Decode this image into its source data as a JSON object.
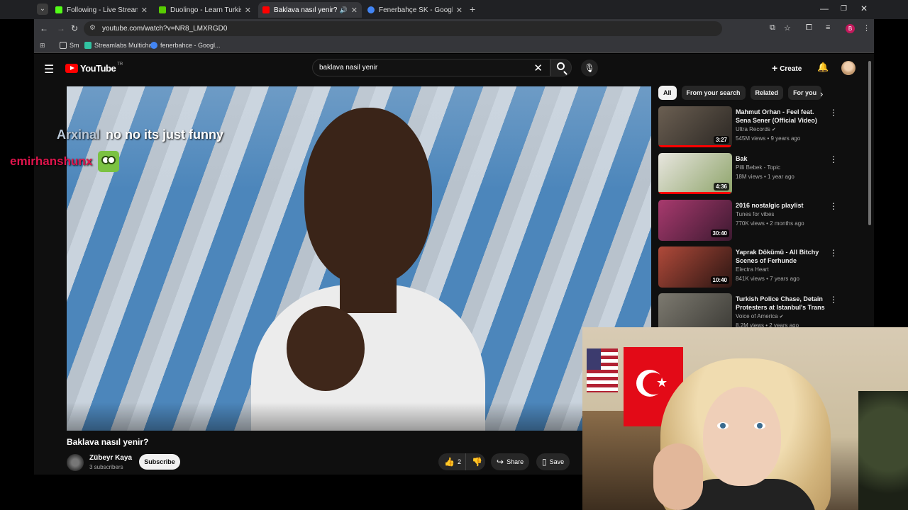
{
  "browser": {
    "tabs": [
      {
        "label": "Following - Live Streams on Ki",
        "favicon_color": "#53fc18",
        "active": false
      },
      {
        "label": "Duolingo - Learn Turkish with I",
        "favicon_color": "#58cc02",
        "active": false
      },
      {
        "label": "Baklava nasıl yenir? - YouTu",
        "favicon_color": "#ff0000",
        "active": true
      },
      {
        "label": "Fenerbahçe SK - Google Search",
        "favicon_color": "#4285f4",
        "active": false
      }
    ],
    "url": "youtube.com/watch?v=NR8_LMXRGD0",
    "profile_initial": "B",
    "bookmarks": [
      {
        "label": "Sm",
        "icon": "folder-icon"
      },
      {
        "label": "Streamlabs Multichat",
        "icon": "streamlabs-icon"
      },
      {
        "label": "fenerbahce - Googl...",
        "icon": "google-icon"
      }
    ]
  },
  "youtube": {
    "logo_text": "YouTube",
    "region": "TR",
    "search_query": "baklava nasil yenir",
    "create_label": "Create",
    "video": {
      "title": "Baklava nasıl yenir?",
      "channel": "Zübeyr Kaya",
      "subscribers": "3 subscribers",
      "subscribe_label": "Subscribe",
      "likes": "2",
      "share_label": "Share",
      "save_label": "Save"
    },
    "chips": [
      "All",
      "From your search",
      "Related",
      "For you"
    ],
    "recommendations": [
      {
        "title": "Mahmut Orhan - Feel feat. Sena Sener (Official Video) [Ultra ...",
        "channel": "Ultra Records",
        "verified": true,
        "meta": "545M views • 9 years ago",
        "duration": "3:27",
        "watched_fraction": 0.98,
        "thumb_colors": [
          "#6b5f52",
          "#2b2723"
        ]
      },
      {
        "title": "Bak",
        "channel": "Pilli Bebek - Topic",
        "verified": false,
        "meta": "18M views • 1 year ago",
        "duration": "4:36",
        "watched_fraction": 0.98,
        "thumb_colors": [
          "#e8e6df",
          "#8ea46a"
        ]
      },
      {
        "title": "2016 nostalgic playlist",
        "channel": "Tunes for vibes",
        "verified": false,
        "meta": "770K views • 2 months ago",
        "duration": "30:40",
        "watched_fraction": 0.0,
        "thumb_colors": [
          "#a83a6e",
          "#3c1930"
        ]
      },
      {
        "title": "Yaprak Dökümü - All Bitchy Scenes of Ferhunde",
        "channel": "Electra Heart",
        "verified": false,
        "meta": "841K views • 7 years ago",
        "duration": "10:40",
        "watched_fraction": 0.0,
        "thumb_colors": [
          "#b04a3a",
          "#2a1512"
        ]
      },
      {
        "title": "Turkish Police Chase, Detain Protesters at Istanbul's Trans ...",
        "channel": "Voice of America",
        "verified": true,
        "meta": "8.2M views • 2 years ago",
        "duration": "",
        "watched_fraction": 0.0,
        "thumb_colors": [
          "#7d7a70",
          "#3b3a35"
        ]
      }
    ]
  },
  "overlay": {
    "chat": [
      {
        "user": "Arxinal",
        "message": "no no its just funny",
        "user_color": "#b9c7d6"
      },
      {
        "user": "emirhanshunx",
        "message": "",
        "user_color": "#e0144c"
      }
    ]
  }
}
